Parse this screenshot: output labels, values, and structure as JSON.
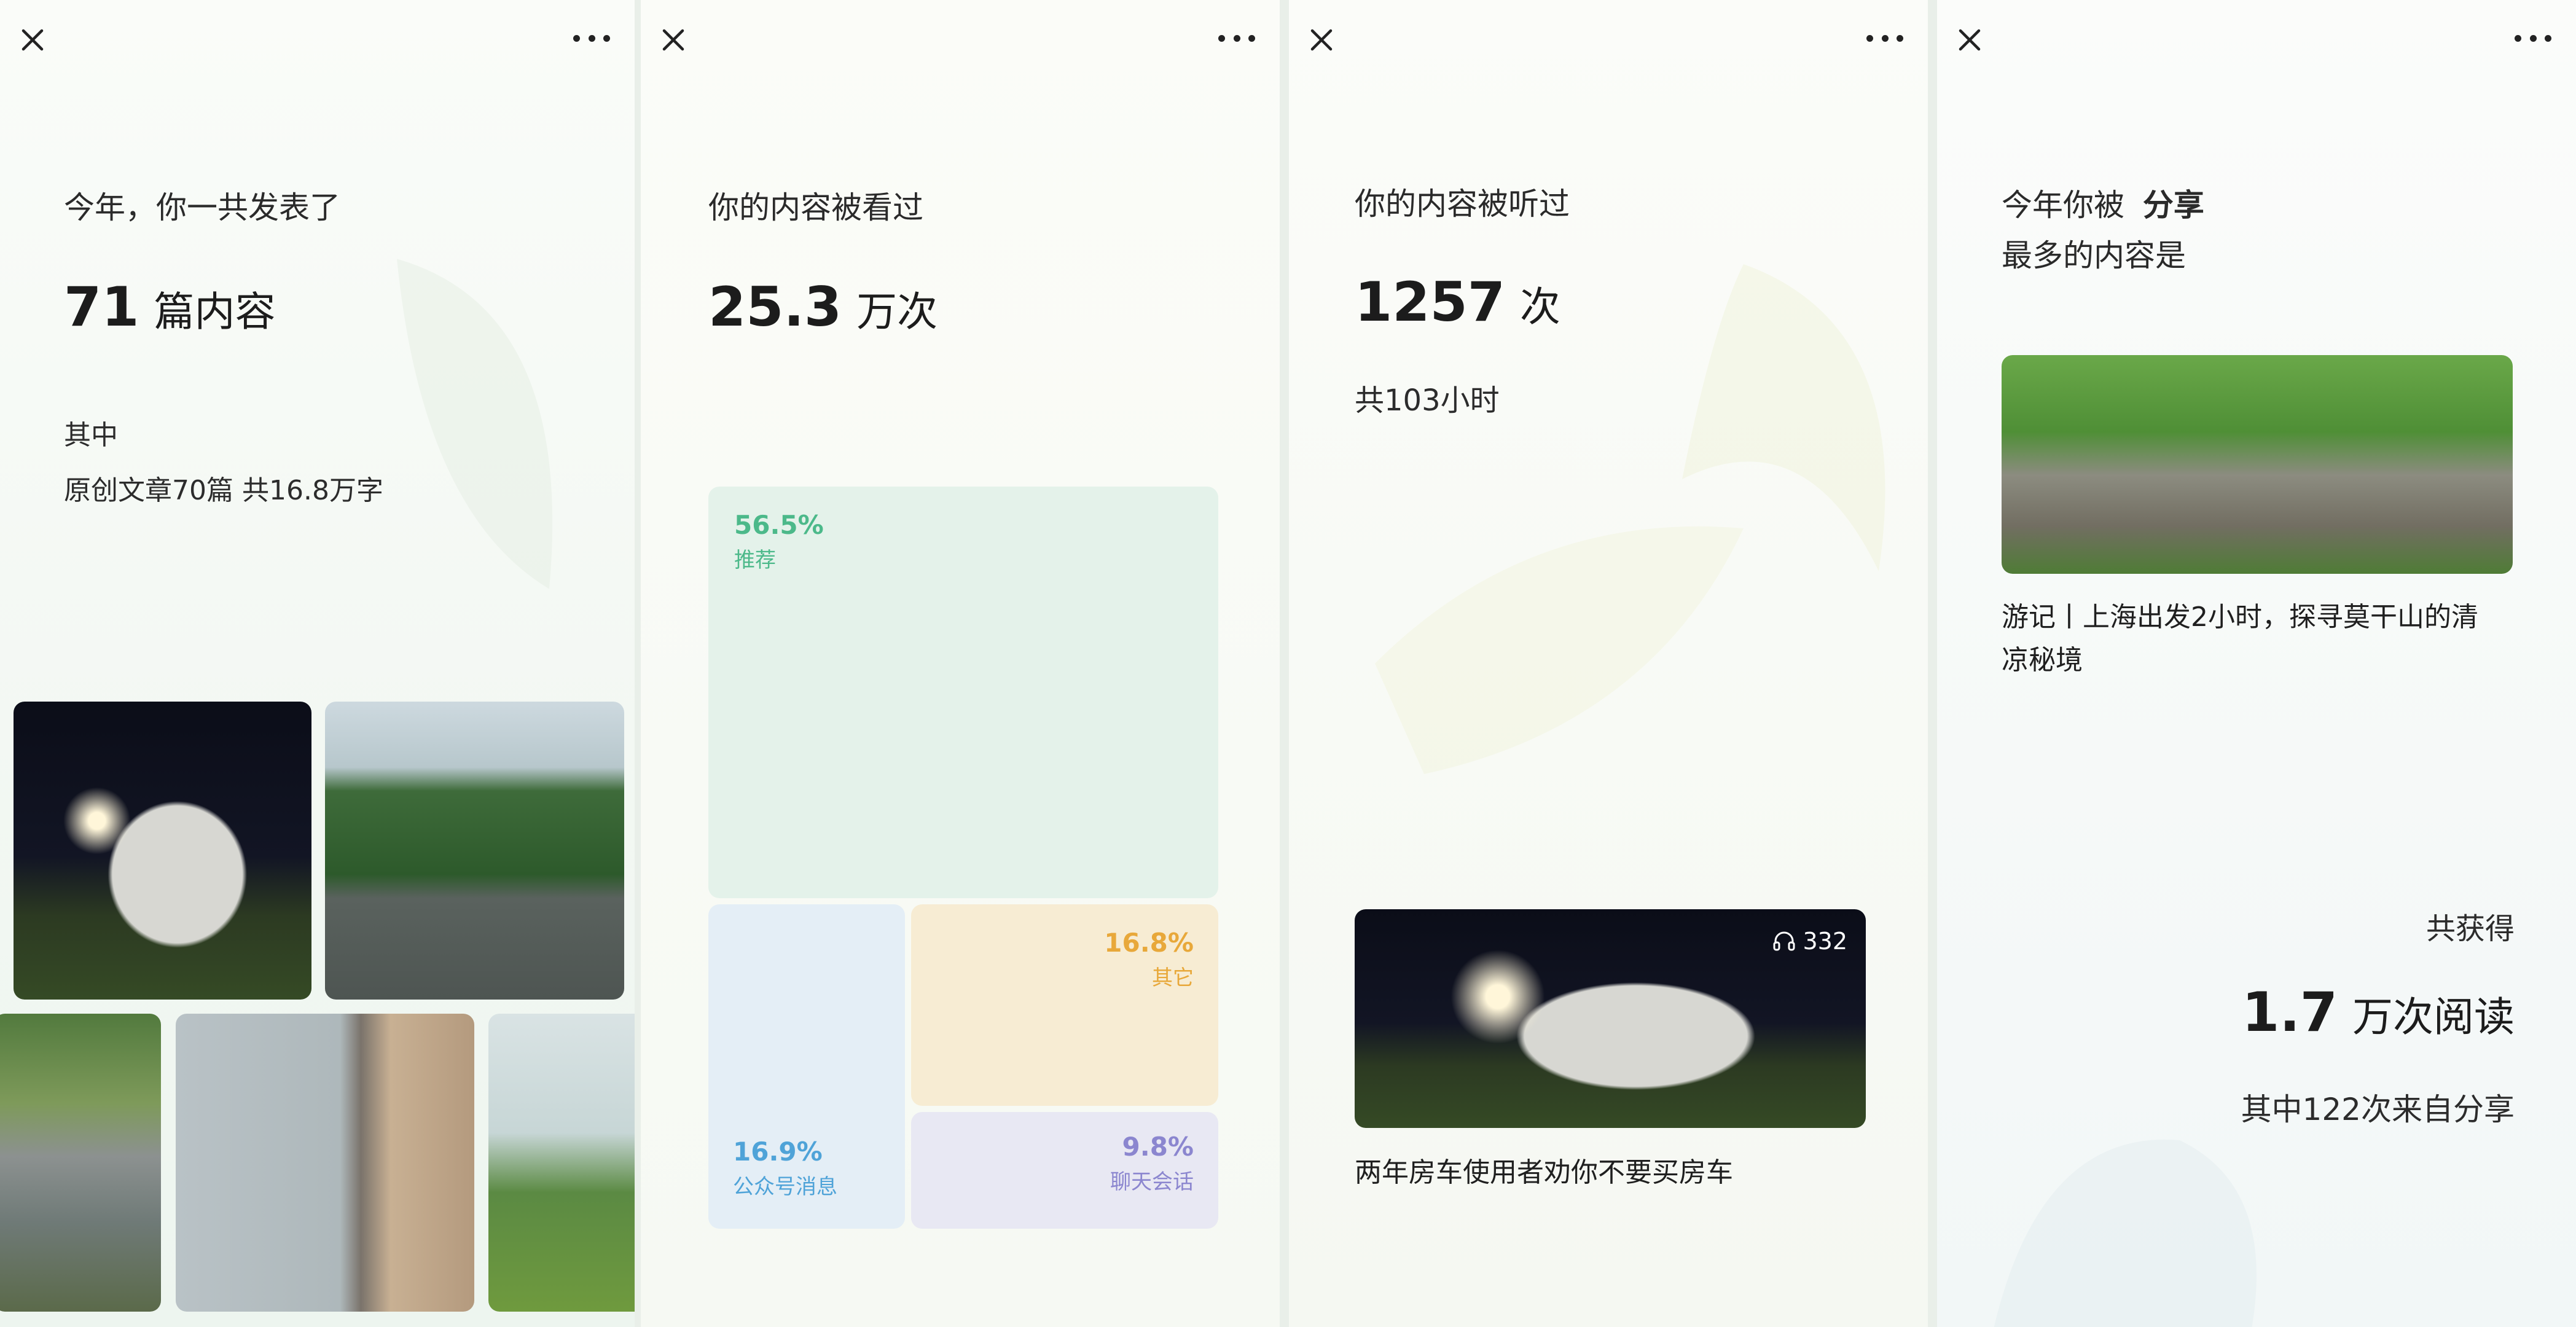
{
  "panel1": {
    "intro": "今年，你一共发表了",
    "count": "71",
    "count_unit": "篇内容",
    "detail_title": "其中",
    "detail_text": "原创文章70篇  共16.8万字"
  },
  "panel2": {
    "intro": "你的内容被看过",
    "count": "25.3",
    "count_unit": "万次",
    "sources": [
      {
        "pct": "56.5%",
        "label": "推荐",
        "color": "#4cb98a"
      },
      {
        "pct": "16.9%",
        "label": "公众号消息",
        "color": "#4fa3d8"
      },
      {
        "pct": "16.8%",
        "label": "其它",
        "color": "#e8a83a"
      },
      {
        "pct": "9.8%",
        "label": "聊天会话",
        "color": "#8b86cf"
      }
    ]
  },
  "panel3": {
    "intro": "你的内容被听过",
    "count": "1257",
    "count_unit": "次",
    "duration": "共103小时",
    "listen_count": "332",
    "article_title": "两年房车使用者劝你不要买房车"
  },
  "panel4": {
    "intro_prefix": "今年你被",
    "intro_emph": "分享",
    "intro_line2": "最多的内容是",
    "article_title_line1": "游记丨上海出发2小时，探寻莫干山的清",
    "article_title_line2": "凉秘境",
    "gain_label": "共获得",
    "reads": "1.7",
    "reads_unit": "万次阅读",
    "share_note": "其中122次来自分享"
  },
  "icons": {
    "close": "close-icon",
    "more": "more-icon",
    "headphones": "headphones-icon"
  }
}
